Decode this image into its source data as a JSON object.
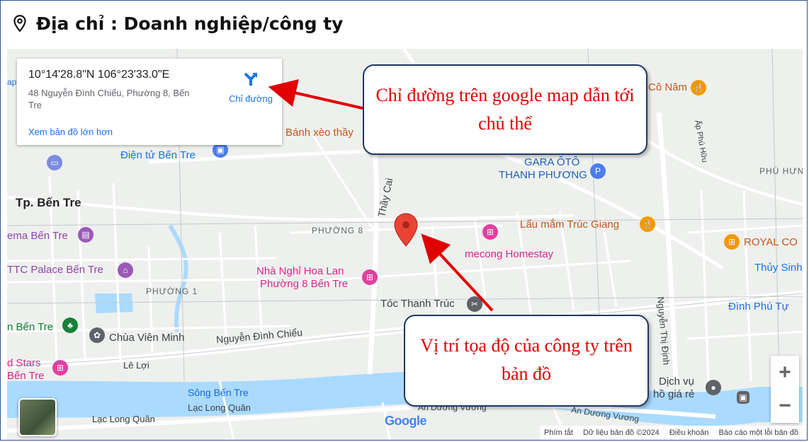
{
  "header": {
    "title": "Địa chỉ : Doanh nghiệp/công ty"
  },
  "infocard": {
    "coordinates": "10°14'28.8\"N 106°23'33.0\"E",
    "address": "48 Nguyễn Đình Chiểu, Phường 8, Bến Tre",
    "directions_label": "Chỉ đường",
    "view_larger_map": "Xem bản đồ lớn hơn"
  },
  "callouts": {
    "directions": "Chỉ đường trên google map dẫn tới chủ thể",
    "location": "Vị trí tọa độ của công ty trên bản đồ"
  },
  "map_labels": {
    "tp_ben_tre": "Tp. Bến Tre",
    "phuong8": "PHƯỜNG 8",
    "phuong1": "PHƯỜNG 1",
    "phu_hung": "PHÚ HƯN",
    "thay_cai": "Thầy Cai",
    "ap_phu_huu": "Ấp Phú Hữu",
    "nguyen_thi_dinh": "Nguyễn Thị Định",
    "nguyen_dinh_chieu": "Nguyễn Đình Chiểu",
    "le_loi": "Lê Lợi",
    "song_ben_tre": "Sông Bến Tre",
    "lac_long_quan_1": "Lạc Long Quân",
    "lac_long_quan_2": "Lạc Long Quân",
    "an_duong_vuong_1": "An Dương Vương",
    "an_duong_vuong_2": "An Dương Vương",
    "dien_tu": "Điện tử Bến Tre",
    "banh_xeo": "Bánh xèo thầy",
    "co_nam": "Cô Năm",
    "gara_1": "GARA ÔTÔ",
    "gara_2": "THANH PHƯƠNG",
    "lau_mam": "Lẩu mắm Trúc Giang",
    "royal": "ROYAL CO",
    "mecong": "mecong Homestay",
    "thuy_sinh": "Thủy Sinh",
    "nha_nghi_1": "Nhà Nghỉ Hoa Lan",
    "nha_nghi_2": "Phường 8 Bến Tre",
    "toc": "Tóc Thanh Trúc",
    "dinh_phu_tu": "Đình Phú Tự",
    "cinema": "ema Bến Tre",
    "ttc": "TTC Palace Bến Tre",
    "ben_tre_park": "n Bến Tre",
    "chua": "Chùa Viên Minh",
    "stars_1": "d Stars",
    "stars_2": "Bến Tre",
    "dich_vu_1": "Dịch vụ",
    "dich_vu_2": "hồ giá rẻ",
    "ap_label": "ap"
  },
  "footer": {
    "shortcuts": "Phím tắt",
    "map_data": "Dữ liệu bản đồ ©2024",
    "terms": "Điều khoản",
    "report": "Báo cáo một lỗi bản đồ"
  },
  "google_logo": "Google",
  "colors": {
    "callout_text": "#e00000",
    "callout_border": "#1f3864",
    "marker": "#ea4335",
    "arrow": "#e00000",
    "river": "#aadaff"
  }
}
